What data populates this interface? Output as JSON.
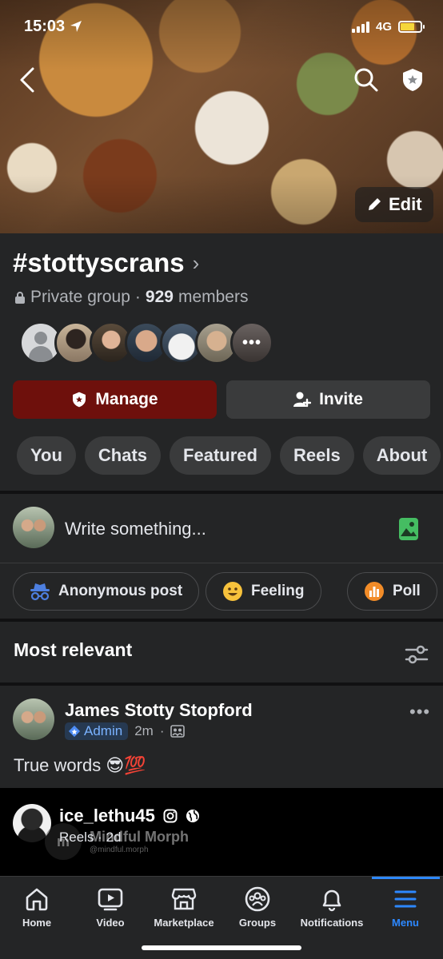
{
  "status_bar": {
    "time": "15:03",
    "network": "4G"
  },
  "cover": {
    "edit_label": "Edit"
  },
  "group": {
    "name": "#stottyscrans",
    "privacy": "Private group",
    "separator": "·",
    "member_count": "929",
    "members_label": "members"
  },
  "actions": {
    "manage_label": "Manage",
    "invite_label": "Invite"
  },
  "tabs": [
    "You",
    "Chats",
    "Featured",
    "Reels",
    "About"
  ],
  "composer": {
    "placeholder": "Write something..."
  },
  "chips": [
    "Anonymous post",
    "Feeling",
    "Poll"
  ],
  "feed": {
    "sort_label": "Most relevant"
  },
  "post": {
    "author": "James Stotty Stopford",
    "role": "Admin",
    "time": "2m",
    "dot": "·",
    "text": "True words",
    "emojis": "😎💯"
  },
  "reel": {
    "username": "ice_lethu45",
    "subtitle": "Reels · 2d",
    "watermark_name": "Mindful Morph",
    "watermark_handle": "@mindful.morph"
  },
  "bottom_nav": {
    "home": "Home",
    "video": "Video",
    "marketplace": "Marketplace",
    "groups": "Groups",
    "notifications": "Notifications",
    "menu": "Menu"
  },
  "colors": {
    "background": "#1c1c1d",
    "surface": "#242526",
    "manage_button": "#6e100c",
    "accent_blue": "#2d88ff",
    "battery": "#f5d63b",
    "photo_icon": "#45bd62"
  }
}
